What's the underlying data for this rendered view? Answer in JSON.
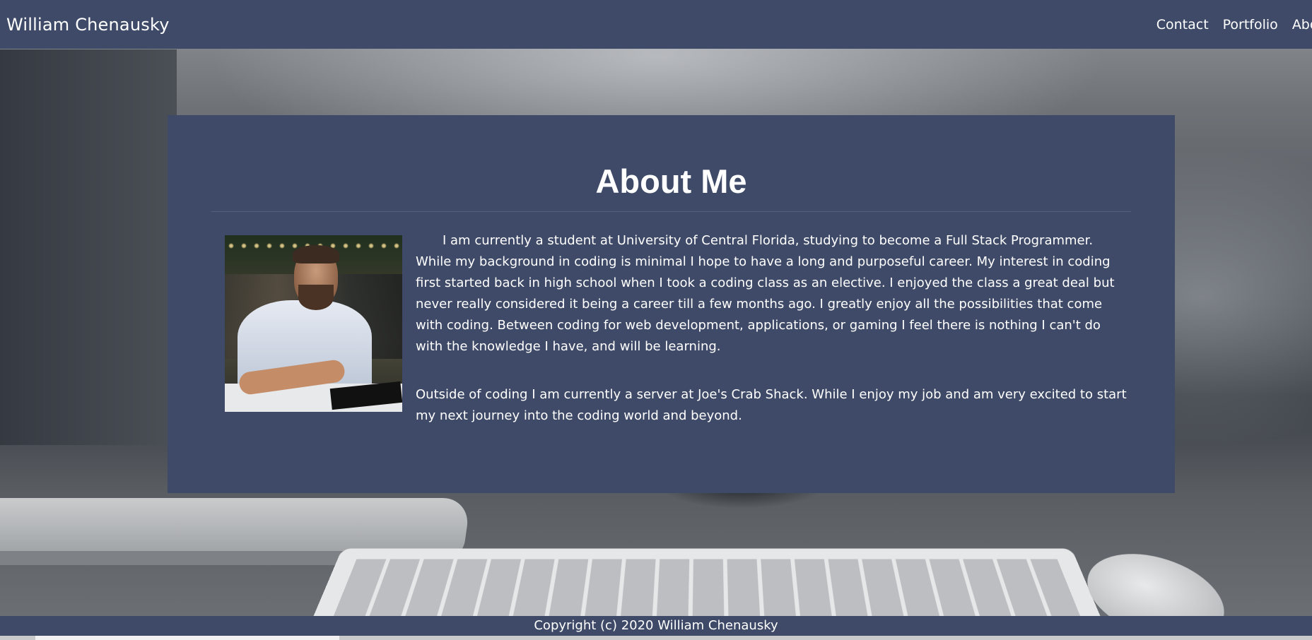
{
  "navbar": {
    "brand": "William Chenausky",
    "links": [
      "Contact",
      "Portfolio",
      "About"
    ]
  },
  "about": {
    "title": "About Me",
    "paragraph1": "I am currently a student at University of Central Florida, studying to become a Full Stack Programmer. While my background in coding is minimal I hope to have a long and purposeful career. My interest in coding first started back in high school when I took a coding class as an elective. I enjoyed the class a great deal but never really considered it being a career till a few months ago. I greatly enjoy all the possibilities that come with coding. Between coding for web development, applications, or gaming I feel there is nothing I can't do with the knowledge I have, and will be learning.",
    "paragraph2": "Outside of coding I am currently a server at Joe's Crab Shack. While I enjoy my job and am very excited to start my next journey into the coding world and beyond."
  },
  "footer": {
    "copyright": "Copyright (c) 2020 William Chenausky"
  },
  "colors": {
    "panel": "#3e4a67",
    "text": "#ffffff"
  }
}
